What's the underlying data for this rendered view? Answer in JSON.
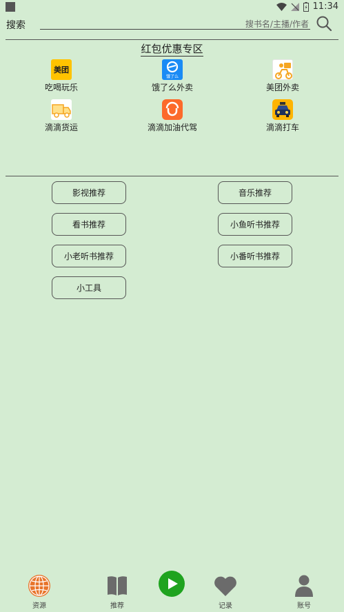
{
  "status_bar": {
    "time": "11:34"
  },
  "search": {
    "label": "搜索",
    "placeholder": "搜书名/主播/作者"
  },
  "promo_section": {
    "title": "红包优惠专区",
    "items": [
      {
        "label": "吃喝玩乐",
        "icon": "meituan-icon",
        "icon_text": "美团"
      },
      {
        "label": "饿了么外卖",
        "icon": "eleme-icon",
        "icon_text": "饿了么"
      },
      {
        "label": "美团外卖",
        "icon": "meituan-delivery-icon"
      },
      {
        "label": "滴滴货运",
        "icon": "didi-freight-truck-icon"
      },
      {
        "label": "滴滴加油代驾",
        "icon": "didi-icon"
      },
      {
        "label": "滴滴打车",
        "icon": "didi-taxi-icon"
      }
    ]
  },
  "recommend_buttons": [
    {
      "label": "影视推荐"
    },
    {
      "label": "音乐推荐"
    },
    {
      "label": "看书推荐"
    },
    {
      "label": "小鱼听书推荐"
    },
    {
      "label": "小老听书推荐"
    },
    {
      "label": "小番听书推荐"
    },
    {
      "label": "小工具"
    }
  ],
  "bottom_nav": [
    {
      "label": "资源",
      "icon": "globe-icon",
      "color": "#e8742a"
    },
    {
      "label": "推荐",
      "icon": "book-icon",
      "color": "#6b6b6b"
    },
    {
      "label": "",
      "icon": "play-icon",
      "color": "#1fa31f"
    },
    {
      "label": "记录",
      "icon": "heart-icon",
      "color": "#6b6b6b"
    },
    {
      "label": "账号",
      "icon": "person-icon",
      "color": "#6b6b6b"
    }
  ]
}
